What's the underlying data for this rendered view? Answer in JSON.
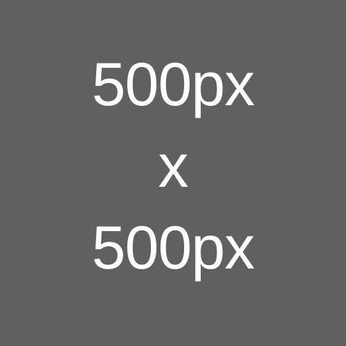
{
  "placeholder": {
    "width_label": "500px",
    "separator": "x",
    "height_label": "500px",
    "background_color": "#606060",
    "text_color": "#ffffff"
  }
}
